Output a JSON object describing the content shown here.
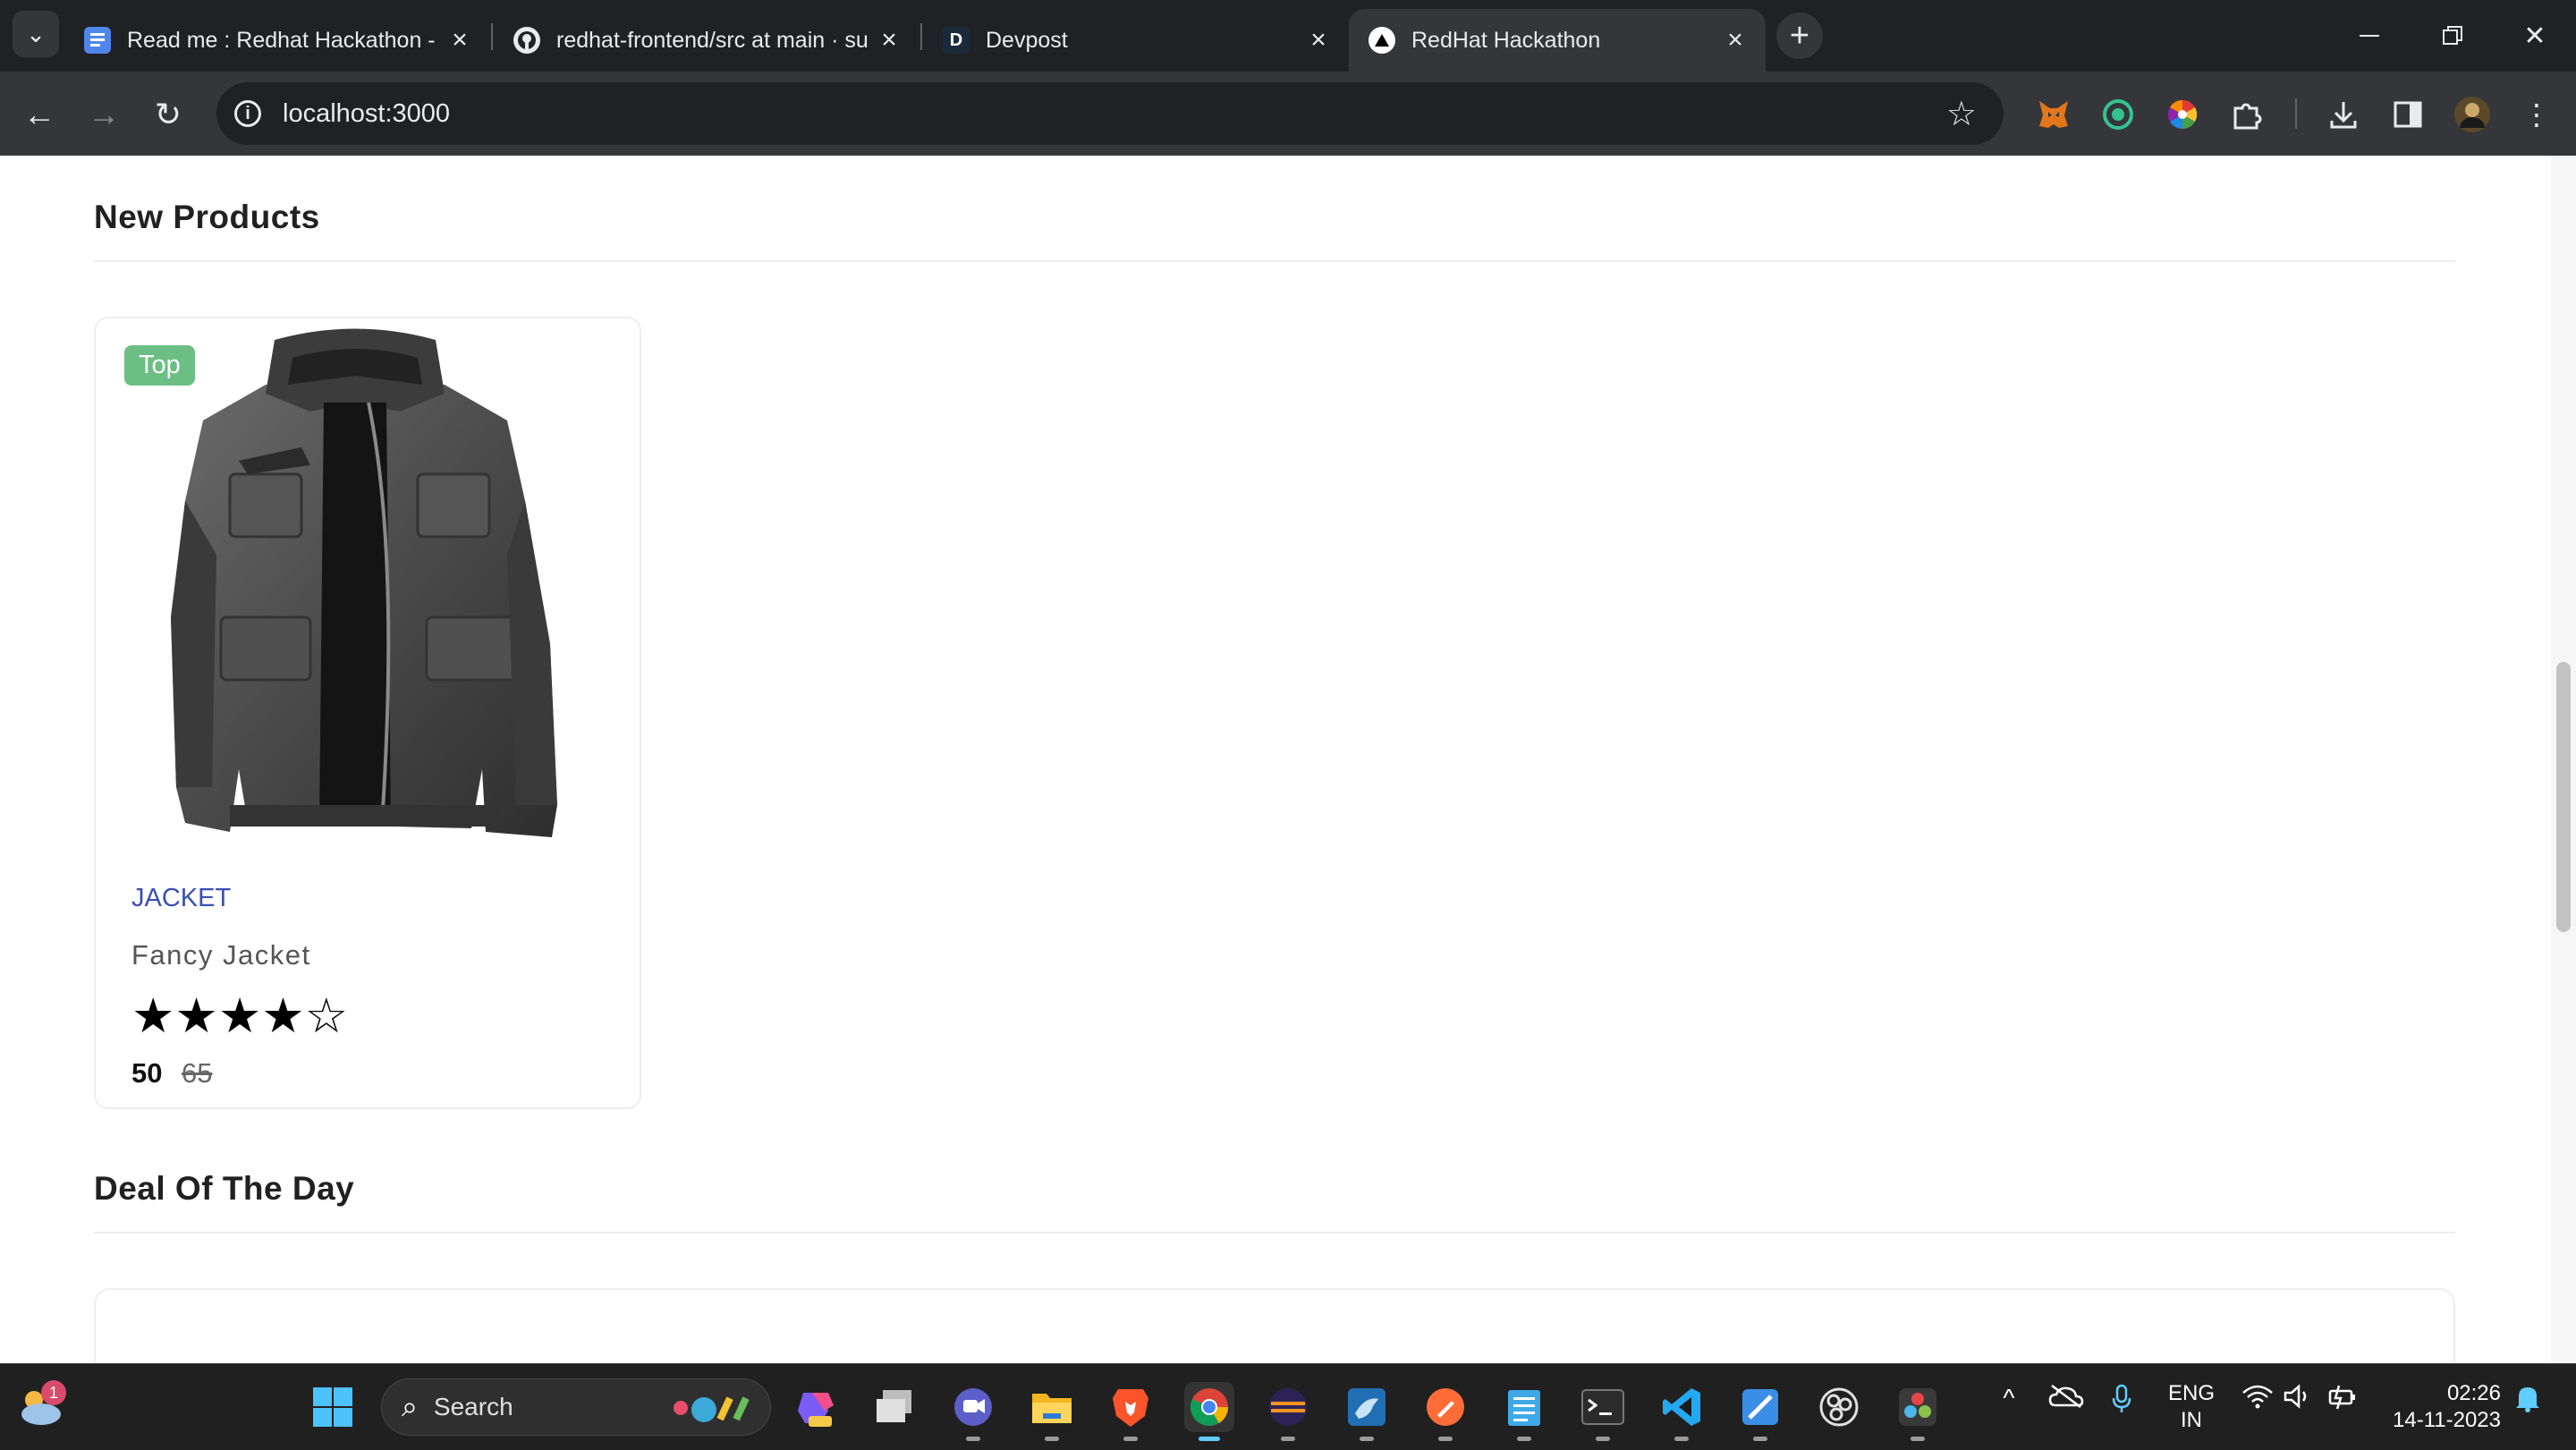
{
  "browser": {
    "tabs": [
      {
        "title": "Read me : Redhat Hackathon - G",
        "icon": "google-docs-icon",
        "active": false
      },
      {
        "title": "redhat-frontend/src at main · su",
        "icon": "github-icon",
        "active": false
      },
      {
        "title": "Devpost",
        "icon": "devpost-icon",
        "active": false
      },
      {
        "title": "RedHat Hackathon",
        "icon": "nextjs-icon",
        "active": true
      }
    ],
    "devpost_letter": "D",
    "url": "localhost:3000",
    "colors": {
      "tabstrip": "#202124",
      "toolbar": "#35363a",
      "omnibox": "#202124"
    }
  },
  "page": {
    "new_products_title": "New Products",
    "deal_title": "Deal Of The Day",
    "products": [
      {
        "badge": "Top",
        "category": "JACKET",
        "name": "Fancy Jacket",
        "rating": 4,
        "rating_max": 5,
        "stars_text": "★★★★☆",
        "price": "50",
        "old_price": "65"
      }
    ],
    "colors": {
      "badge": "#6cbf84",
      "category": "#3b4fb5"
    }
  },
  "taskbar": {
    "search_label": "Search",
    "weather_notification_count": "1",
    "language": "ENG",
    "region": "IN",
    "time": "02:26",
    "date": "14-11-2023"
  }
}
